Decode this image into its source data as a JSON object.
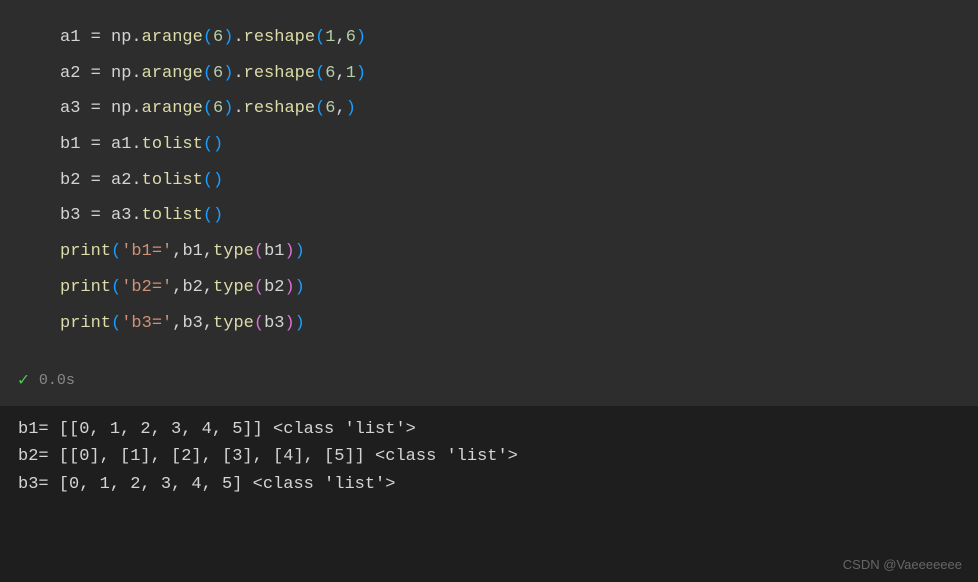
{
  "code": {
    "l1": {
      "var": "a1",
      "obj": "np",
      "m1": "arange",
      "n1": "6",
      "m2": "reshape",
      "n2": "1",
      "n3": "6"
    },
    "l2": {
      "var": "a2",
      "obj": "np",
      "m1": "arange",
      "n1": "6",
      "m2": "reshape",
      "n2": "6",
      "n3": "1"
    },
    "l3": {
      "var": "a3",
      "obj": "np",
      "m1": "arange",
      "n1": "6",
      "m2": "reshape",
      "n2": "6"
    },
    "l4": {
      "var": "b1",
      "obj": "a1",
      "m1": "tolist"
    },
    "l5": {
      "var": "b2",
      "obj": "a2",
      "m1": "tolist"
    },
    "l6": {
      "var": "b3",
      "obj": "a3",
      "m1": "tolist"
    },
    "l7": {
      "fn": "print",
      "s": "'b1='",
      "v": "b1",
      "t": "type",
      "v2": "b1"
    },
    "l8": {
      "fn": "print",
      "s": "'b2='",
      "v": "b2",
      "t": "type",
      "v2": "b2"
    },
    "l9": {
      "fn": "print",
      "s": "'b3='",
      "v": "b3",
      "t": "type",
      "v2": "b3"
    }
  },
  "status": {
    "time": "0.0s"
  },
  "output": {
    "l1": "b1= [[0, 1, 2, 3, 4, 5]] <class 'list'>",
    "l2": "b2= [[0], [1], [2], [3], [4], [5]] <class 'list'>",
    "l3": "b3= [0, 1, 2, 3, 4, 5] <class 'list'>"
  },
  "watermark": "CSDN @Vaeeeeeee"
}
